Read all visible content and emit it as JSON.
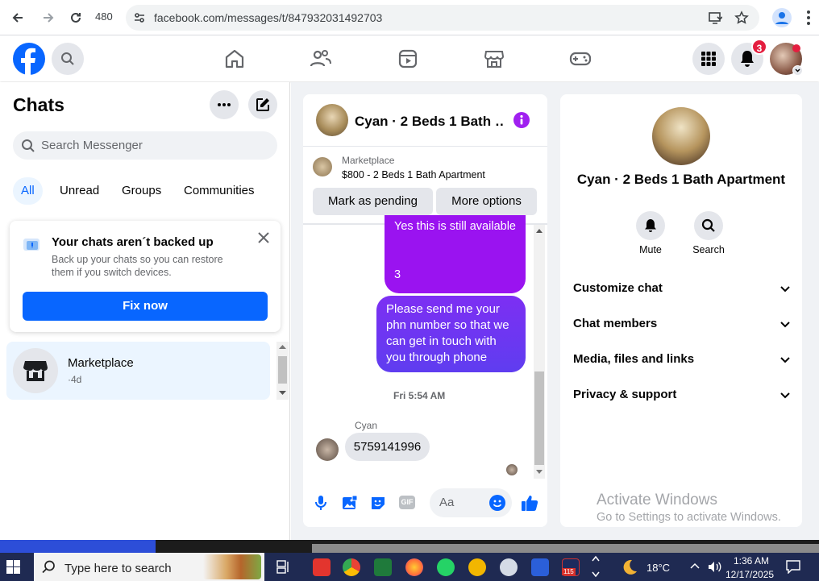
{
  "browser": {
    "zoom": "480",
    "url": "facebook.com/messages/t/847932031492703"
  },
  "nav": {
    "notification_count": "3"
  },
  "left": {
    "title": "Chats",
    "search_placeholder": "Search Messenger",
    "tabs": [
      "All",
      "Unread",
      "Groups",
      "Communities"
    ],
    "backup": {
      "title": "Your chats aren´t backed up",
      "desc": "Back up your chats so you can restore them if you switch devices.",
      "button": "Fix now"
    },
    "chat_item": {
      "name": "Marketplace",
      "time": "·4d"
    }
  },
  "conversation": {
    "header_name": "Cyan · 2 Beds 1 Bath …",
    "marketplace_label": "Marketplace",
    "listing": "$800 - 2 Beds 1 Bath Apartment",
    "buttons": [
      "Mark as pending",
      "More options"
    ],
    "messages": {
      "m1_line1": "Yes this is still available",
      "m1_line2": "3",
      "m2": "Please send me your phn number so that we can get in touch with you through phone",
      "timestamp": "Fri 5:54 AM",
      "sender": "Cyan",
      "m3": "5759141996"
    },
    "composer_placeholder": "Aa"
  },
  "info": {
    "name": "Cyan · 2 Beds 1 Bath Apartment",
    "actions": [
      "Mute",
      "Search"
    ],
    "rows": [
      "Customize chat",
      "Chat members",
      "Media, files and links",
      "Privacy & support"
    ]
  },
  "watermark": {
    "line1": "Activate Windows",
    "line2": "Go to Settings to activate Windows."
  },
  "taskbar": {
    "search": "Type here to search",
    "temperature": "18°C",
    "time": "1:36 AM",
    "date": "12/17/2025",
    "badge": "115"
  },
  "colors": {
    "fb_blue": "#0866ff",
    "purple": "#9a13f0",
    "bubble_blue": "#5f3df0"
  }
}
